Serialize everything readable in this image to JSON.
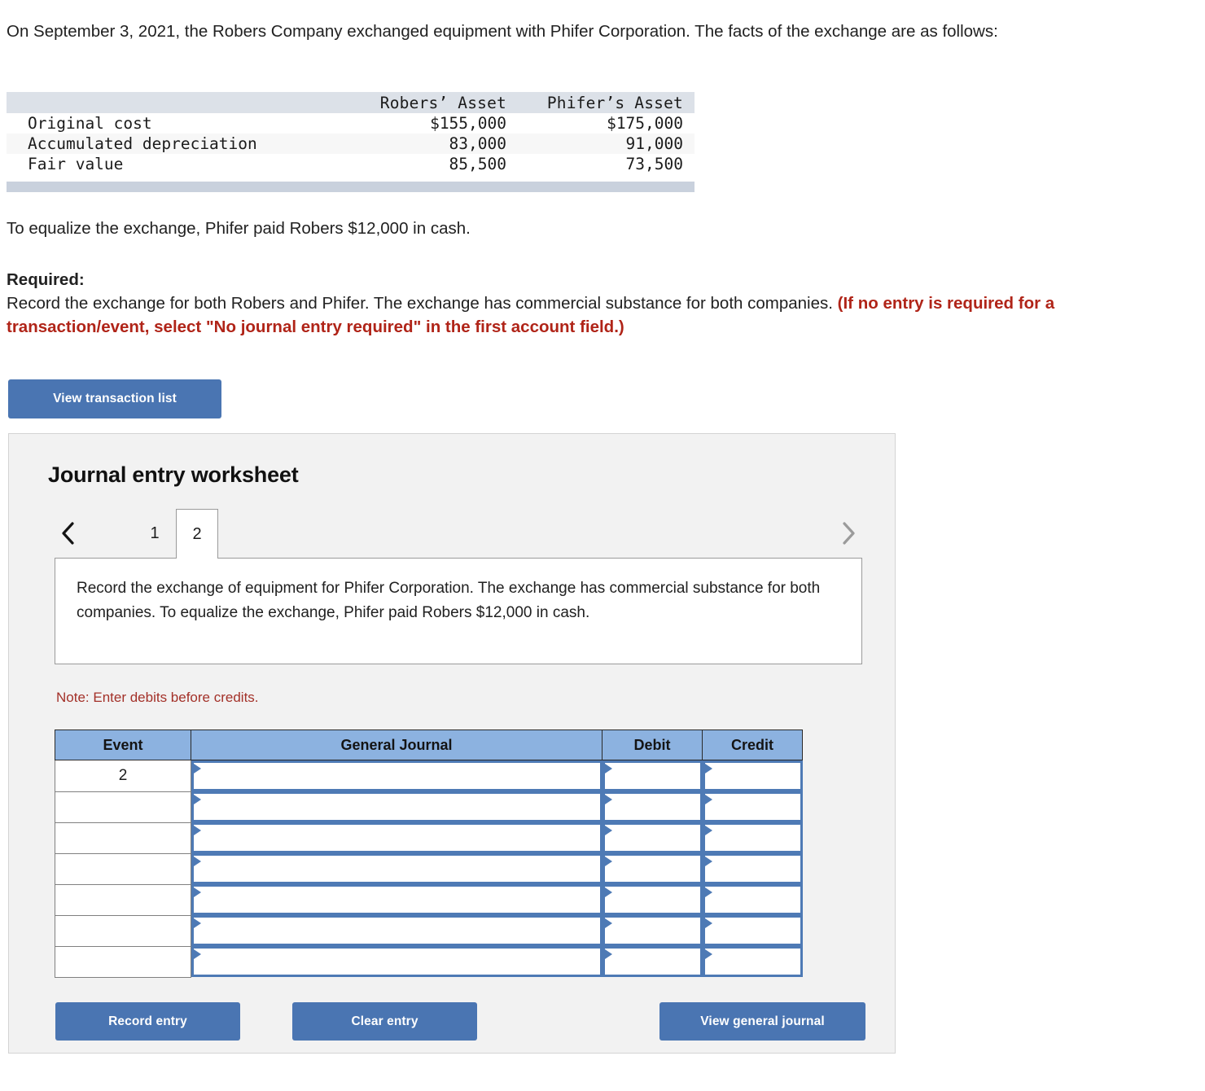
{
  "intro": {
    "paragraph": "On September 3, 2021, the Robers Company exchanged equipment with Phifer Corporation. The facts of the exchange are as follows:"
  },
  "facts_table": {
    "columns": [
      "",
      "Robers’ Asset",
      "Phifer’s Asset"
    ],
    "rows": [
      {
        "label": "Original cost",
        "robers": "$155,000",
        "phifer": "$175,000"
      },
      {
        "label": "Accumulated depreciation",
        "robers": "83,000",
        "phifer": "91,000"
      },
      {
        "label": "Fair value",
        "robers": "85,500",
        "phifer": "73,500"
      }
    ]
  },
  "equalize_note": "To equalize the exchange, Phifer paid Robers $12,000 in cash.",
  "required": {
    "heading": "Required:",
    "body": "Record the exchange for both Robers and Phifer. The exchange has commercial substance for both companies. ",
    "emphasis": "(If no entry is required for a transaction/event, select \"No journal entry required\" in the first account field.)"
  },
  "buttons": {
    "view_transaction_list": "View transaction list",
    "record_entry": "Record entry",
    "clear_entry": "Clear entry",
    "view_general_journal": "View general journal"
  },
  "worksheet": {
    "title": "Journal entry worksheet",
    "tabs": [
      {
        "label": "1",
        "active": false
      },
      {
        "label": "2",
        "active": true
      }
    ],
    "nav": {
      "prev_icon": "chevron-left-icon",
      "next_icon": "chevron-right-icon"
    },
    "description": "Record the exchange of equipment for Phifer Corporation. The exchange has commercial substance for both companies. To equalize the exchange, Phifer paid Robers $12,000 in cash.",
    "note": "Note: Enter debits before credits.",
    "journal_table": {
      "headers": [
        "Event",
        "General Journal",
        "Debit",
        "Credit"
      ],
      "rows": [
        {
          "event": "2",
          "general_journal": "",
          "debit": "",
          "credit": ""
        },
        {
          "event": "",
          "general_journal": "",
          "debit": "",
          "credit": ""
        },
        {
          "event": "",
          "general_journal": "",
          "debit": "",
          "credit": ""
        },
        {
          "event": "",
          "general_journal": "",
          "debit": "",
          "credit": ""
        },
        {
          "event": "",
          "general_journal": "",
          "debit": "",
          "credit": ""
        },
        {
          "event": "",
          "general_journal": "",
          "debit": "",
          "credit": ""
        },
        {
          "event": "",
          "general_journal": "",
          "debit": "",
          "credit": ""
        }
      ]
    }
  },
  "colors": {
    "button_blue": "#4a75b2",
    "table_header_blue": "#8cb2e0",
    "facts_header": "#dce1e8",
    "facts_footer": "#c9d1dd",
    "note_red": "#a33129",
    "required_red": "#b02418",
    "panel_gray": "#f2f2f2"
  }
}
